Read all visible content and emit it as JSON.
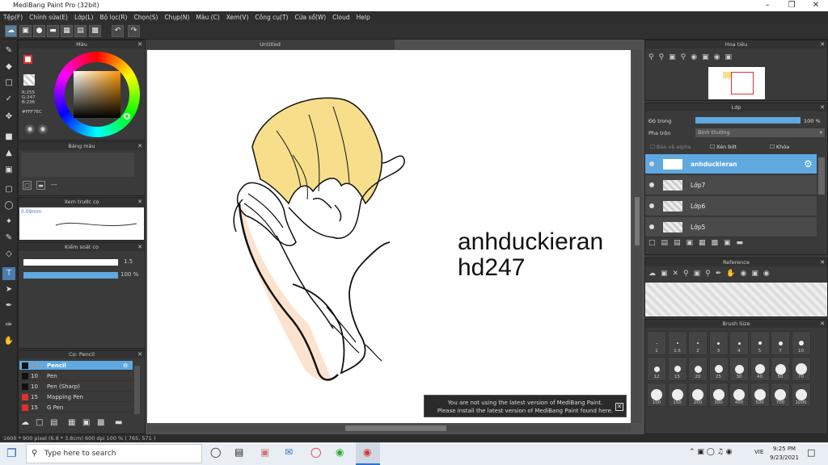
{
  "app": {
    "title": "MediBang Paint Pro (32bit)"
  },
  "menu": [
    "Tệp(F)",
    "Chỉnh sửa(E)",
    "Lớp(L)",
    "Bộ lọc(R)",
    "Chọn(S)",
    "Chụp(N)",
    "Màu (C)",
    "Xem(V)",
    "Công cụ(T)",
    "Cửa sổ(W)",
    "Cloud",
    "Help"
  ],
  "color_panel": {
    "title": "Màu",
    "r": "R:255",
    "g": "G:247",
    "b": "B:236",
    "hex": "#FFF7EC"
  },
  "palette_panel": {
    "title": "Bảng màu",
    "dash": "---"
  },
  "preview_panel": {
    "title": "Xem trước cọ",
    "size": "0.09mm"
  },
  "control_panel": {
    "title": "Kiểm soát cọ",
    "width": "1.5",
    "opacity": "100 %"
  },
  "brush_panel": {
    "title": "Cọ: Pencil",
    "items": [
      {
        "size": "1.5",
        "name": "Pencil",
        "color": "#111111"
      },
      {
        "size": "10",
        "name": "Pen",
        "color": "#111111"
      },
      {
        "size": "10",
        "name": "Pen (Sharp)",
        "color": "#111111"
      },
      {
        "size": "15",
        "name": "Mapping Pen",
        "color": "#e03030"
      },
      {
        "size": "15",
        "name": "G Pen",
        "color": "#e03030"
      }
    ]
  },
  "document": {
    "tab": "Untitled",
    "text1": "anhduckieran",
    "text2": "hd247"
  },
  "navigator": {
    "title": "Hoa tiêu"
  },
  "layer_panel": {
    "title": "Lớp",
    "opacity_label": "Độ trong",
    "opacity_value": "100 %",
    "blend_label": "Pha trộn",
    "blend_value": "Bình thường",
    "alpha_label": "Bảo vệ alpha",
    "clip_label": "Xén bớt",
    "lock_label": "Khóa",
    "layers": [
      "anhduckieran",
      "Lớp7",
      "Lớp6",
      "Lớp5"
    ]
  },
  "reference_panel": {
    "title": "Reference"
  },
  "brush_size_panel": {
    "title": "Brush Size",
    "sizes": [
      "1",
      "1.5",
      "2",
      "3",
      "4",
      "5",
      "7",
      "10",
      "12",
      "15",
      "20",
      "25",
      "30",
      "40",
      "50",
      "70",
      "100",
      "150",
      "200",
      "300",
      "400",
      "500",
      "700",
      "1000"
    ]
  },
  "notice": {
    "line1": "You are not using the latest version of MediBang Paint.",
    "line2": "Please install the latest version of MediBang Paint found here."
  },
  "status": {
    "text": "1600 * 900 pixel   (6.8 * 3.8cm)   600 dpi   100 %   ( 765, 571 )"
  },
  "taskbar": {
    "search_placeholder": "Type here to search",
    "time": "9:25 PM",
    "date": "9/23/2021",
    "lang": "VIE"
  }
}
